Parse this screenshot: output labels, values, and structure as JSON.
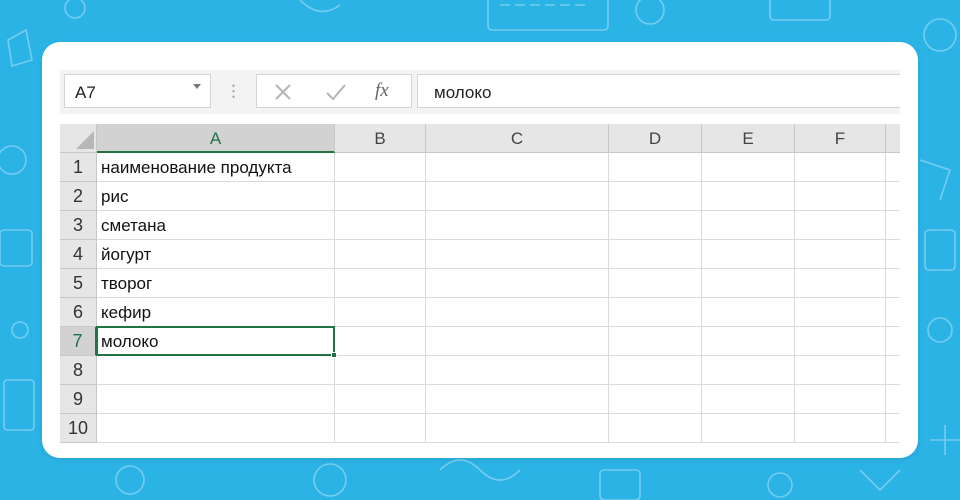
{
  "name_box": {
    "value": "A7"
  },
  "formula_bar": {
    "cancel_icon": "cancel-icon",
    "enter_icon": "checkmark-icon",
    "fx_label": "fx",
    "value": "молоко"
  },
  "columns": [
    "A",
    "B",
    "C",
    "D",
    "E",
    "F"
  ],
  "selected_column": "A",
  "rows": [
    "1",
    "2",
    "3",
    "4",
    "5",
    "6",
    "7",
    "8",
    "9",
    "10"
  ],
  "selected_row": "7",
  "cells": {
    "A1": "наименование продукта",
    "A2": "рис",
    "A3": "сметана",
    "A4": "йогурт",
    "A5": "творог",
    "A6": "кефир",
    "A7": "молоко"
  },
  "active_cell": "A7",
  "colors": {
    "background": "#2bb3e6",
    "selection": "#217346"
  }
}
